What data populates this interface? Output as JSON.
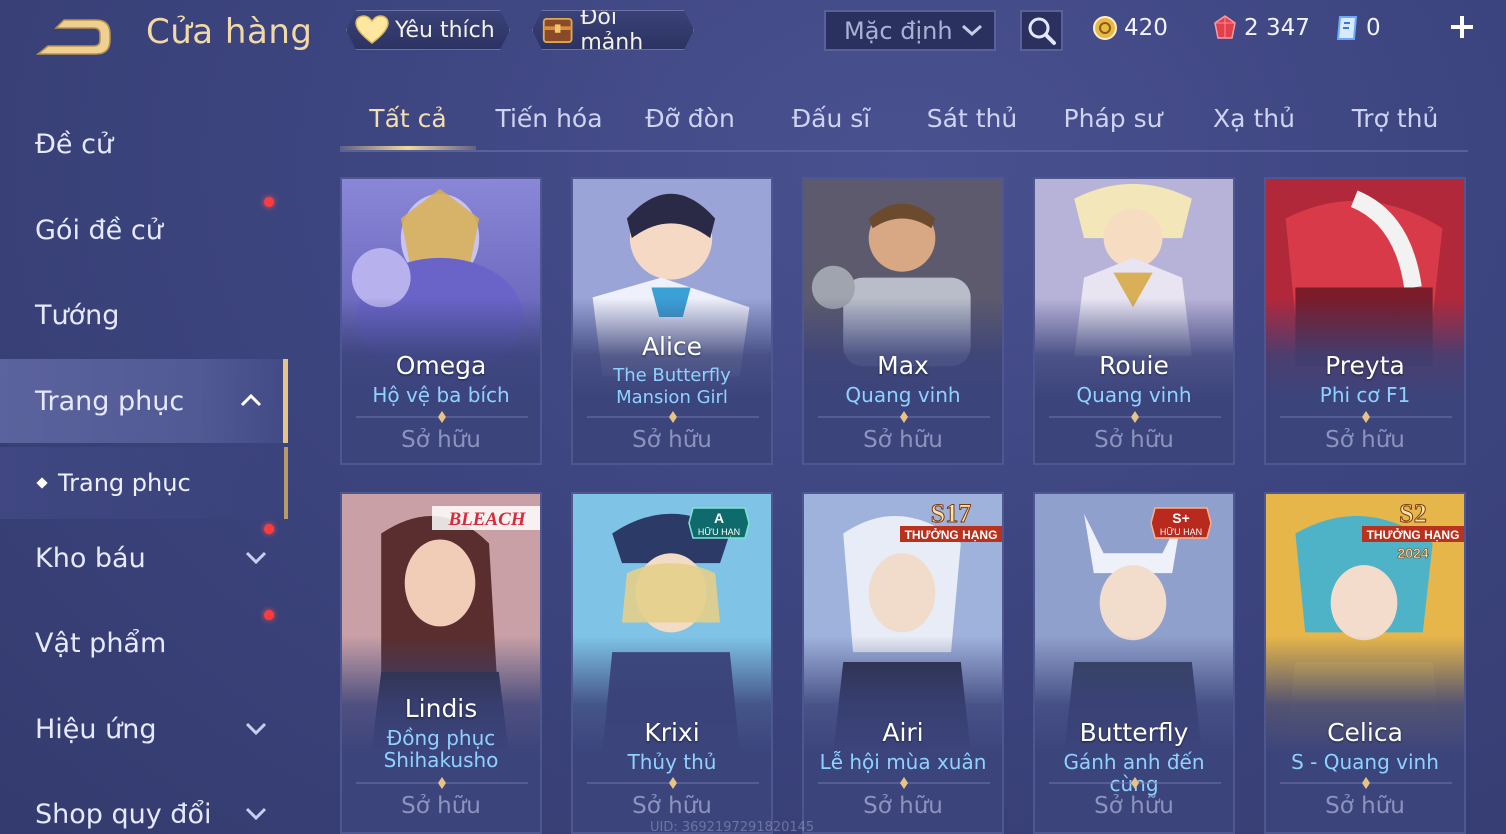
{
  "header": {
    "title": "Cửa hàng",
    "favorites_label": "Yêu thích",
    "trade_label": "Đổi mảnh",
    "sort_value": "Mặc định"
  },
  "currency": {
    "gold": "420",
    "gems": "2 347",
    "tickets": "0"
  },
  "sidebar": {
    "items": [
      {
        "label": "Đề cử"
      },
      {
        "label": "Gói đề cử"
      },
      {
        "label": "Tướng"
      },
      {
        "label": "Trang phục"
      },
      {
        "label": "Kho báu"
      },
      {
        "label": "Vật phẩm"
      },
      {
        "label": "Hiệu ứng"
      },
      {
        "label": "Shop quy đổi"
      }
    ],
    "sub_item": "Trang phục"
  },
  "tabs": [
    {
      "label": "Tất cả"
    },
    {
      "label": "Tiến hóa"
    },
    {
      "label": "Đỡ đòn"
    },
    {
      "label": "Đấu sĩ"
    },
    {
      "label": "Sát thủ"
    },
    {
      "label": "Pháp sư"
    },
    {
      "label": "Xạ thủ"
    },
    {
      "label": "Trợ thủ"
    }
  ],
  "cards": [
    {
      "hero": "Omega",
      "skin": "Hộ vệ ba bích",
      "status": "Sở hữu"
    },
    {
      "hero": "Alice",
      "skin": "The Butterfly Mansion Girl",
      "status": "Sở hữu"
    },
    {
      "hero": "Max",
      "skin": "Quang vinh",
      "status": "Sở hữu"
    },
    {
      "hero": "Rouie",
      "skin": "Quang vinh",
      "status": "Sở hữu"
    },
    {
      "hero": "Preyta",
      "skin": "Phi cơ F1",
      "status": "Sở hữu"
    },
    {
      "hero": "Lindis",
      "skin": "Đồng phục Shihakusho",
      "status": "Sở hữu",
      "badge": "BLEACH"
    },
    {
      "hero": "Krixi",
      "skin": "Thủy thủ",
      "status": "Sở hữu",
      "badge": "A",
      "badge_sub": "HỮU HẠN"
    },
    {
      "hero": "Airi",
      "skin": "Lễ hội mùa xuân",
      "status": "Sở hữu",
      "badge": "S17",
      "badge_sub": "THƯỞNG HẠNG"
    },
    {
      "hero": "Butterfly",
      "skin": "Gánh anh đến cùng",
      "status": "Sở hữu",
      "badge": "S+",
      "badge_sub": "HỮU HẠN"
    },
    {
      "hero": "Celica",
      "skin": "S - Quang vinh",
      "status": "Sở hữu",
      "badge": "S2",
      "badge_sub": "THƯỞNG HẠNG",
      "badge_year": "2024"
    }
  ],
  "footer": {
    "uid": "UID: 3692197291820145"
  },
  "colors": {
    "accent_gold": "#f1d89a",
    "skin_name_blue": "#8fd2ff",
    "notification_red": "#ff3b3b",
    "background": "#3d4580"
  }
}
